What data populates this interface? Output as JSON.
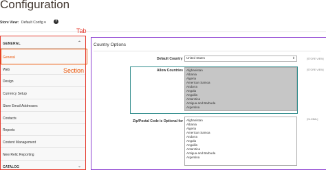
{
  "page": {
    "title": "Configuration"
  },
  "scope": {
    "label": "Store View:",
    "value": "Default Config",
    "help": "?"
  },
  "annotations": {
    "tab": "Tab",
    "section": "Section"
  },
  "nav": {
    "header": "GENERAL",
    "header_icon": "chevron-up-icon",
    "items": [
      {
        "label": "General"
      },
      {
        "label": "Web"
      },
      {
        "label": "Design"
      },
      {
        "label": "Currency Setup"
      },
      {
        "label": "Store Email Addresses"
      },
      {
        "label": "Contacts"
      },
      {
        "label": "Reports"
      },
      {
        "label": "Content Management"
      },
      {
        "label": "New Relic Reporting"
      }
    ],
    "catalog": "CATALOG",
    "catalog_icon": "chevron-down-icon"
  },
  "group": {
    "title": "Country Options"
  },
  "fields": {
    "default_country": {
      "label": "Default Country",
      "value": "United States",
      "scope": "[STORE VIEW]"
    },
    "allow_countries": {
      "label": "Allow Countries",
      "scope": "[STORE VIEW]",
      "options": [
        "Afghanistan",
        "Albania",
        "Algeria",
        "American Samoa",
        "Andorra",
        "Angola",
        "Anguilla",
        "Antarctica",
        "Antigua and Barbuda",
        "Argentina"
      ]
    },
    "zip_optional": {
      "label": "Zip/Postal Code is Optional for",
      "scope": "[GLOBAL]",
      "options": [
        "Afghanistan",
        "Albania",
        "Algeria",
        "American Samoa",
        "Andorra",
        "Angola",
        "Anguilla",
        "Antarctica",
        "Antigua and Barbuda",
        "Argentina"
      ]
    }
  },
  "colors": {
    "tab_annotation": "#e63b2e",
    "section_annotation": "#eb5202",
    "main_annotation": "#8a3bd0",
    "field_annotation": "#2e8b8b"
  }
}
